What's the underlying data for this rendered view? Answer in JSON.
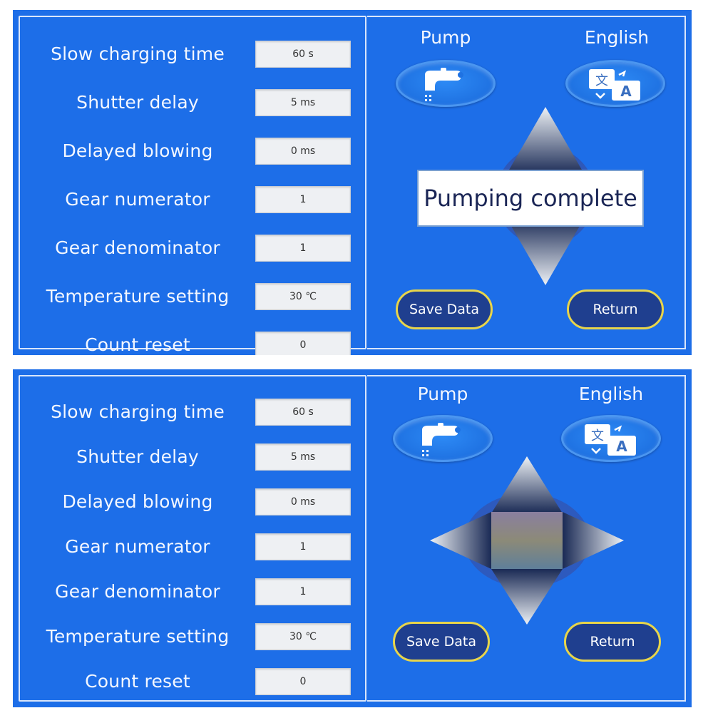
{
  "screens": [
    {
      "params": [
        {
          "label": "Slow charging time",
          "value": "60 s"
        },
        {
          "label": "Shutter delay",
          "value": "5 ms"
        },
        {
          "label": "Delayed blowing",
          "value": "0 ms"
        },
        {
          "label": "Gear numerator",
          "value": "1"
        },
        {
          "label": "Gear denominator",
          "value": "1"
        },
        {
          "label": "Temperature setting",
          "value": "30 ℃"
        },
        {
          "label": "Count reset",
          "value": "0"
        }
      ],
      "pump_label": "Pump",
      "language_label": "English",
      "save_label": "Save Data",
      "return_label": "Return",
      "popup_message": "Pumping complete",
      "pump_icon": "faucet-icon",
      "language_icon": "translate-icon"
    },
    {
      "params": [
        {
          "label": "Slow charging time",
          "value": "60 s"
        },
        {
          "label": "Shutter delay",
          "value": "5 ms"
        },
        {
          "label": "Delayed blowing",
          "value": "0 ms"
        },
        {
          "label": "Gear numerator",
          "value": "1"
        },
        {
          "label": "Gear denominator",
          "value": "1"
        },
        {
          "label": "Temperature setting",
          "value": "30 ℃"
        },
        {
          "label": "Count reset",
          "value": "0"
        }
      ],
      "pump_label": "Pump",
      "language_label": "English",
      "save_label": "Save Data",
      "return_label": "Return",
      "pump_icon": "faucet-icon",
      "language_icon": "translate-icon"
    }
  ],
  "colors": {
    "panel_blue": "#1d6ee8",
    "button_navy": "#1f3f8f",
    "button_border_yellow": "#e8d54a"
  }
}
